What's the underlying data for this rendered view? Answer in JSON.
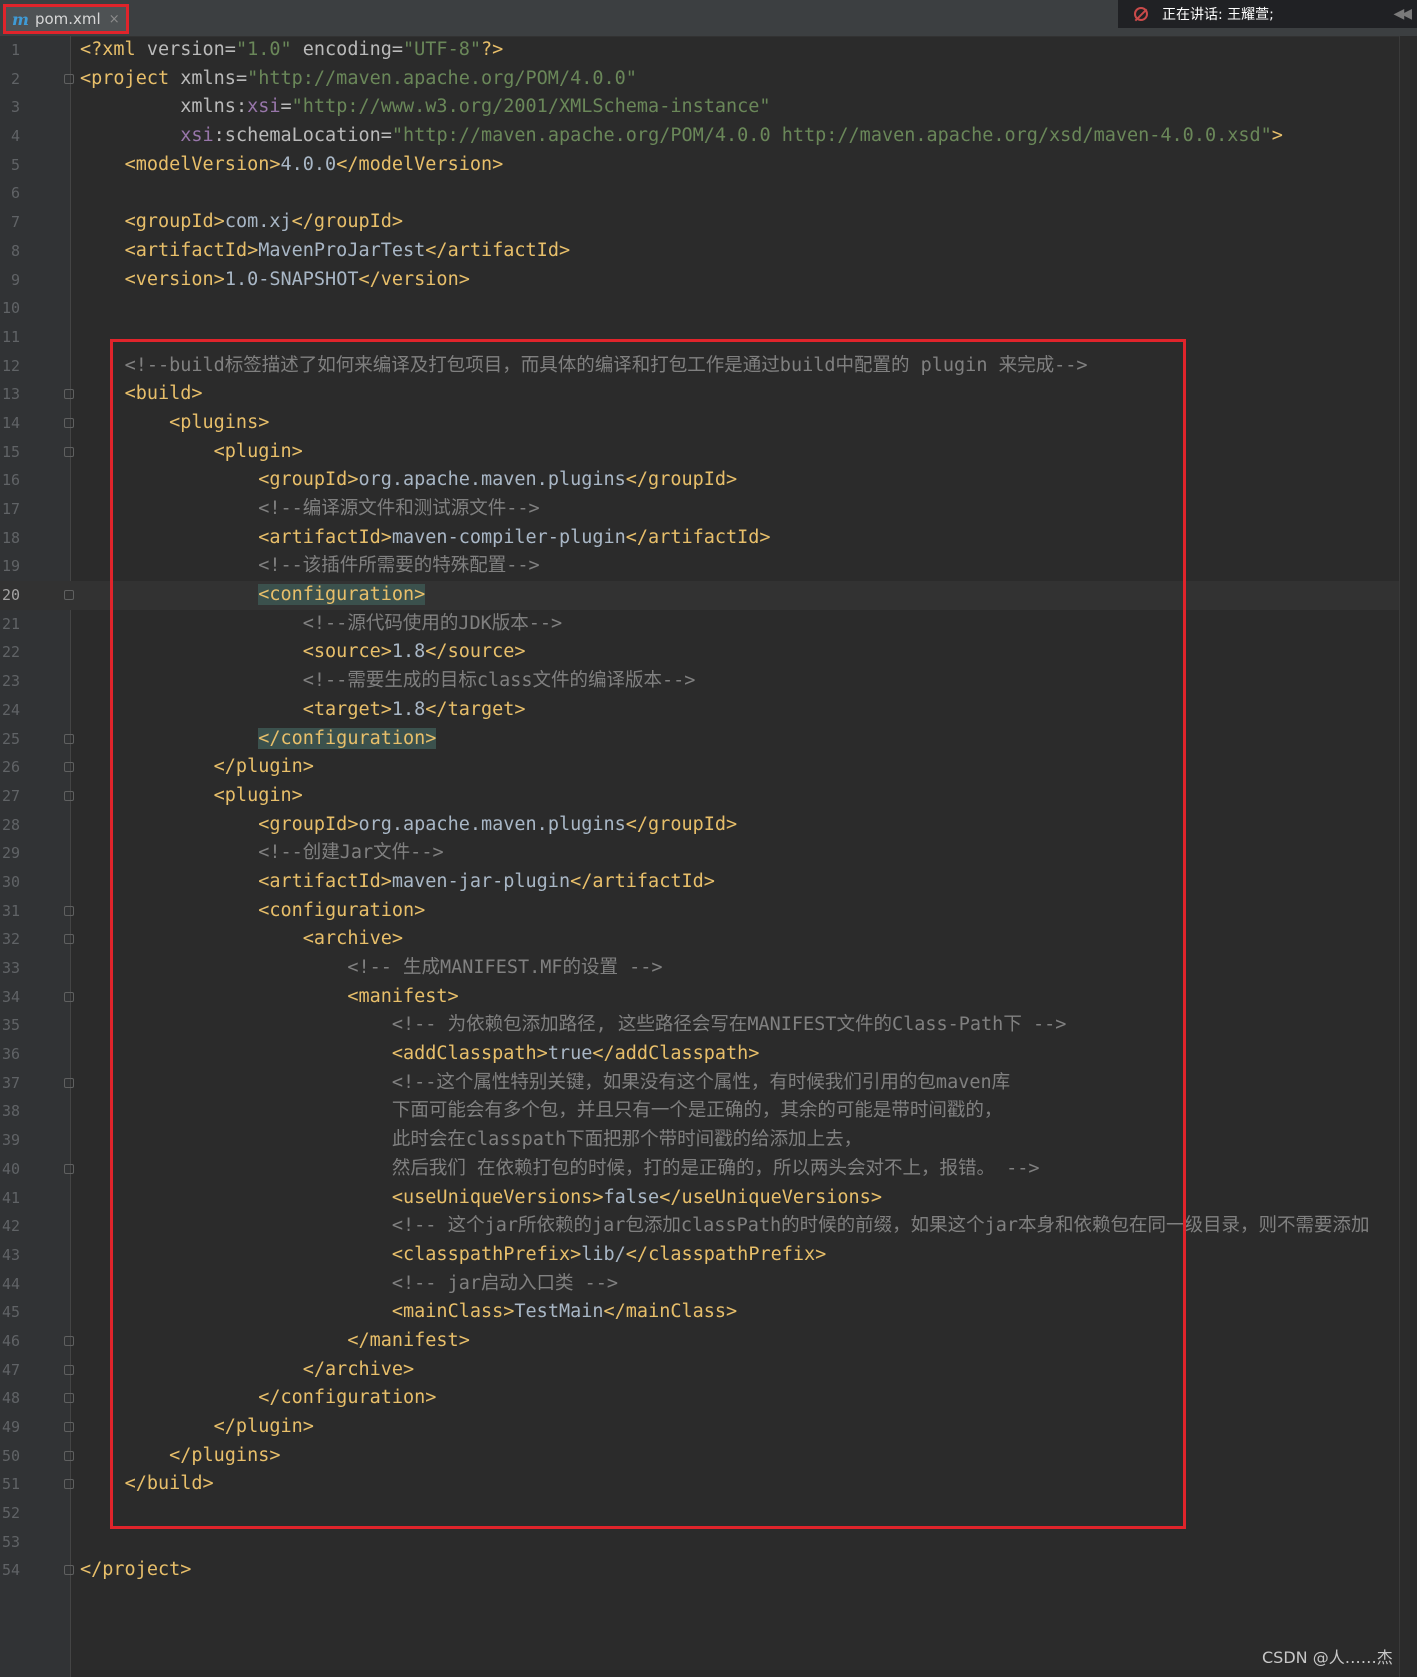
{
  "tab": {
    "icon": "m",
    "label": "pom.xml",
    "close": "×"
  },
  "meeting": {
    "status": "正在讲话: 王耀萱;",
    "arrows": "◀◀"
  },
  "watermark": "CSDN @人……杰",
  "colors": {
    "tag": "#e8bf6a",
    "value": "#6a8759",
    "comment": "#808080",
    "namespace": "#9876aa",
    "text": "#a9b7c6",
    "highlight": "#e0242b"
  },
  "editor": {
    "current_line": 20,
    "lines": [
      {
        "n": "1",
        "tokens": [
          [
            "tag",
            "<?xml "
          ],
          [
            "attr",
            "version="
          ],
          [
            "val",
            "\"1.0\" "
          ],
          [
            "attr",
            "encoding="
          ],
          [
            "val",
            "\"UTF-8\""
          ],
          [
            "tag",
            "?>"
          ]
        ]
      },
      {
        "n": "2",
        "fold": true,
        "tokens": [
          [
            "tag",
            "<project "
          ],
          [
            "attr",
            "xmlns="
          ],
          [
            "val",
            "\"http://maven.apache.org/POM/4.0.0\""
          ]
        ]
      },
      {
        "n": "3",
        "tokens": [
          [
            "txt",
            "         "
          ],
          [
            "attr",
            "xmlns:"
          ],
          [
            "ns",
            "xsi"
          ],
          [
            "attr",
            "="
          ],
          [
            "val",
            "\"http://www.w3.org/2001/XMLSchema-instance\""
          ]
        ]
      },
      {
        "n": "4",
        "tokens": [
          [
            "txt",
            "         "
          ],
          [
            "ns",
            "xsi"
          ],
          [
            "attr",
            ":schemaLocation="
          ],
          [
            "val",
            "\"http://maven.apache.org/POM/4.0.0 http://maven.apache.org/xsd/maven-4.0.0.xsd\""
          ],
          [
            "tag",
            ">"
          ]
        ]
      },
      {
        "n": "5",
        "tokens": [
          [
            "txt",
            "    "
          ],
          [
            "tag",
            "<modelVersion>"
          ],
          [
            "txt",
            "4.0.0"
          ],
          [
            "tag",
            "</modelVersion>"
          ]
        ]
      },
      {
        "n": "6",
        "tokens": []
      },
      {
        "n": "7",
        "tokens": [
          [
            "txt",
            "    "
          ],
          [
            "tag",
            "<groupId>"
          ],
          [
            "txt",
            "com.xj"
          ],
          [
            "tag",
            "</groupId>"
          ]
        ]
      },
      {
        "n": "8",
        "tokens": [
          [
            "txt",
            "    "
          ],
          [
            "tag",
            "<artifactId>"
          ],
          [
            "txt",
            "MavenProJarTest"
          ],
          [
            "tag",
            "</artifactId>"
          ]
        ]
      },
      {
        "n": "9",
        "tokens": [
          [
            "txt",
            "    "
          ],
          [
            "tag",
            "<version>"
          ],
          [
            "txt",
            "1.0-SNAPSHOT"
          ],
          [
            "tag",
            "</version>"
          ]
        ]
      },
      {
        "n": "10",
        "tokens": []
      },
      {
        "n": "11",
        "tokens": []
      },
      {
        "n": "12",
        "tokens": [
          [
            "txt",
            "    "
          ],
          [
            "cmt",
            "<!--build标签描述了如何来编译及打包项目，而具体的编译和打包工作是通过build中配置的 plugin 来完成-->"
          ]
        ]
      },
      {
        "n": "13",
        "fold": true,
        "tokens": [
          [
            "txt",
            "    "
          ],
          [
            "tag",
            "<build>"
          ]
        ]
      },
      {
        "n": "14",
        "fold": true,
        "tokens": [
          [
            "txt",
            "        "
          ],
          [
            "tag",
            "<plugins>"
          ]
        ]
      },
      {
        "n": "15",
        "fold": true,
        "tokens": [
          [
            "txt",
            "            "
          ],
          [
            "tag",
            "<plugin>"
          ]
        ]
      },
      {
        "n": "16",
        "tokens": [
          [
            "txt",
            "                "
          ],
          [
            "tag",
            "<groupId>"
          ],
          [
            "txt",
            "org.apache.maven.plugins"
          ],
          [
            "tag",
            "</groupId>"
          ]
        ]
      },
      {
        "n": "17",
        "tokens": [
          [
            "txt",
            "                "
          ],
          [
            "cmt",
            "<!--编译源文件和测试源文件-->"
          ]
        ]
      },
      {
        "n": "18",
        "tokens": [
          [
            "txt",
            "                "
          ],
          [
            "tag",
            "<artifactId>"
          ],
          [
            "txt",
            "maven-compiler-plugin"
          ],
          [
            "tag",
            "</artifactId>"
          ]
        ]
      },
      {
        "n": "19",
        "tokens": [
          [
            "txt",
            "                "
          ],
          [
            "cmt",
            "<!--该插件所需要的特殊配置-->"
          ]
        ]
      },
      {
        "n": "20",
        "fold": true,
        "tokens": [
          [
            "txt",
            "                "
          ],
          [
            "taghl",
            "<configuration>"
          ]
        ]
      },
      {
        "n": "21",
        "tokens": [
          [
            "txt",
            "                    "
          ],
          [
            "cmt",
            "<!--源代码使用的JDK版本-->"
          ]
        ]
      },
      {
        "n": "22",
        "tokens": [
          [
            "txt",
            "                    "
          ],
          [
            "tag",
            "<source>"
          ],
          [
            "txt",
            "1.8"
          ],
          [
            "tag",
            "</source>"
          ]
        ]
      },
      {
        "n": "23",
        "tokens": [
          [
            "txt",
            "                    "
          ],
          [
            "cmt",
            "<!--需要生成的目标class文件的编译版本-->"
          ]
        ]
      },
      {
        "n": "24",
        "tokens": [
          [
            "txt",
            "                    "
          ],
          [
            "tag",
            "<target>"
          ],
          [
            "txt",
            "1.8"
          ],
          [
            "tag",
            "</target>"
          ]
        ]
      },
      {
        "n": "25",
        "fold": true,
        "tokens": [
          [
            "txt",
            "                "
          ],
          [
            "taghl",
            "</configuration>"
          ]
        ]
      },
      {
        "n": "26",
        "fold": true,
        "tokens": [
          [
            "txt",
            "            "
          ],
          [
            "tag",
            "</plugin>"
          ]
        ]
      },
      {
        "n": "27",
        "fold": true,
        "tokens": [
          [
            "txt",
            "            "
          ],
          [
            "tag",
            "<plugin>"
          ]
        ]
      },
      {
        "n": "28",
        "tokens": [
          [
            "txt",
            "                "
          ],
          [
            "tag",
            "<groupId>"
          ],
          [
            "txt",
            "org.apache.maven.plugins"
          ],
          [
            "tag",
            "</groupId>"
          ]
        ]
      },
      {
        "n": "29",
        "tokens": [
          [
            "txt",
            "                "
          ],
          [
            "cmt",
            "<!--创建Jar文件-->"
          ]
        ]
      },
      {
        "n": "30",
        "tokens": [
          [
            "txt",
            "                "
          ],
          [
            "tag",
            "<artifactId>"
          ],
          [
            "txt",
            "maven-jar-plugin"
          ],
          [
            "tag",
            "</artifactId>"
          ]
        ]
      },
      {
        "n": "31",
        "fold": true,
        "tokens": [
          [
            "txt",
            "                "
          ],
          [
            "tag",
            "<configuration>"
          ]
        ]
      },
      {
        "n": "32",
        "fold": true,
        "tokens": [
          [
            "txt",
            "                    "
          ],
          [
            "tag",
            "<archive>"
          ]
        ]
      },
      {
        "n": "33",
        "tokens": [
          [
            "txt",
            "                        "
          ],
          [
            "cmt",
            "<!-- 生成MANIFEST.MF的设置 -->"
          ]
        ]
      },
      {
        "n": "34",
        "fold": true,
        "tokens": [
          [
            "txt",
            "                        "
          ],
          [
            "tag",
            "<manifest>"
          ]
        ]
      },
      {
        "n": "35",
        "tokens": [
          [
            "txt",
            "                            "
          ],
          [
            "cmt",
            "<!-- 为依赖包添加路径, 这些路径会写在MANIFEST文件的Class-Path下 -->"
          ]
        ]
      },
      {
        "n": "36",
        "tokens": [
          [
            "txt",
            "                            "
          ],
          [
            "tag",
            "<addClasspath>"
          ],
          [
            "txt",
            "true"
          ],
          [
            "tag",
            "</addClasspath>"
          ]
        ]
      },
      {
        "n": "37",
        "fold": true,
        "tokens": [
          [
            "txt",
            "                            "
          ],
          [
            "cmt",
            "<!--这个属性特别关键，如果没有这个属性，有时候我们引用的包maven库"
          ]
        ]
      },
      {
        "n": "38",
        "tokens": [
          [
            "txt",
            "                            "
          ],
          [
            "cmt",
            "下面可能会有多个包，并且只有一个是正确的，其余的可能是带时间戳的，"
          ]
        ]
      },
      {
        "n": "39",
        "tokens": [
          [
            "txt",
            "                            "
          ],
          [
            "cmt",
            "此时会在classpath下面把那个带时间戳的给添加上去，"
          ]
        ]
      },
      {
        "n": "40",
        "fold": true,
        "tokens": [
          [
            "txt",
            "                            "
          ],
          [
            "cmt",
            "然后我们 在依赖打包的时候，打的是正确的，所以两头会对不上，报错。 -->"
          ]
        ]
      },
      {
        "n": "41",
        "tokens": [
          [
            "txt",
            "                            "
          ],
          [
            "tag",
            "<useUniqueVersions>"
          ],
          [
            "txt",
            "false"
          ],
          [
            "tag",
            "</useUniqueVersions>"
          ]
        ]
      },
      {
        "n": "42",
        "tokens": [
          [
            "txt",
            "                            "
          ],
          [
            "cmt",
            "<!-- 这个jar所依赖的jar包添加classPath的时候的前缀，如果这个jar本身和依赖包在同一级目录，则不需要添加"
          ]
        ]
      },
      {
        "n": "43",
        "tokens": [
          [
            "txt",
            "                            "
          ],
          [
            "tag",
            "<classpathPrefix>"
          ],
          [
            "txt",
            "lib/"
          ],
          [
            "tag",
            "</classpathPrefix>"
          ]
        ]
      },
      {
        "n": "44",
        "tokens": [
          [
            "txt",
            "                            "
          ],
          [
            "cmt",
            "<!-- jar启动入口类 -->"
          ]
        ]
      },
      {
        "n": "45",
        "tokens": [
          [
            "txt",
            "                            "
          ],
          [
            "tag",
            "<mainClass>"
          ],
          [
            "txt",
            "TestMain"
          ],
          [
            "tag",
            "</mainClass>"
          ]
        ]
      },
      {
        "n": "46",
        "fold": true,
        "tokens": [
          [
            "txt",
            "                        "
          ],
          [
            "tag",
            "</manifest>"
          ]
        ]
      },
      {
        "n": "47",
        "fold": true,
        "tokens": [
          [
            "txt",
            "                    "
          ],
          [
            "tag",
            "</archive>"
          ]
        ]
      },
      {
        "n": "48",
        "fold": true,
        "tokens": [
          [
            "txt",
            "                "
          ],
          [
            "tag",
            "</configuration>"
          ]
        ]
      },
      {
        "n": "49",
        "fold": true,
        "tokens": [
          [
            "txt",
            "            "
          ],
          [
            "tag",
            "</plugin>"
          ]
        ]
      },
      {
        "n": "50",
        "fold": true,
        "tokens": [
          [
            "txt",
            "        "
          ],
          [
            "tag",
            "</plugins>"
          ]
        ]
      },
      {
        "n": "51",
        "fold": true,
        "tokens": [
          [
            "txt",
            "    "
          ],
          [
            "tag",
            "</build>"
          ]
        ]
      },
      {
        "n": "52",
        "tokens": []
      },
      {
        "n": "53",
        "tokens": []
      },
      {
        "n": "54",
        "fold": true,
        "tokens": [
          [
            "tag",
            "</project>"
          ]
        ]
      }
    ]
  }
}
